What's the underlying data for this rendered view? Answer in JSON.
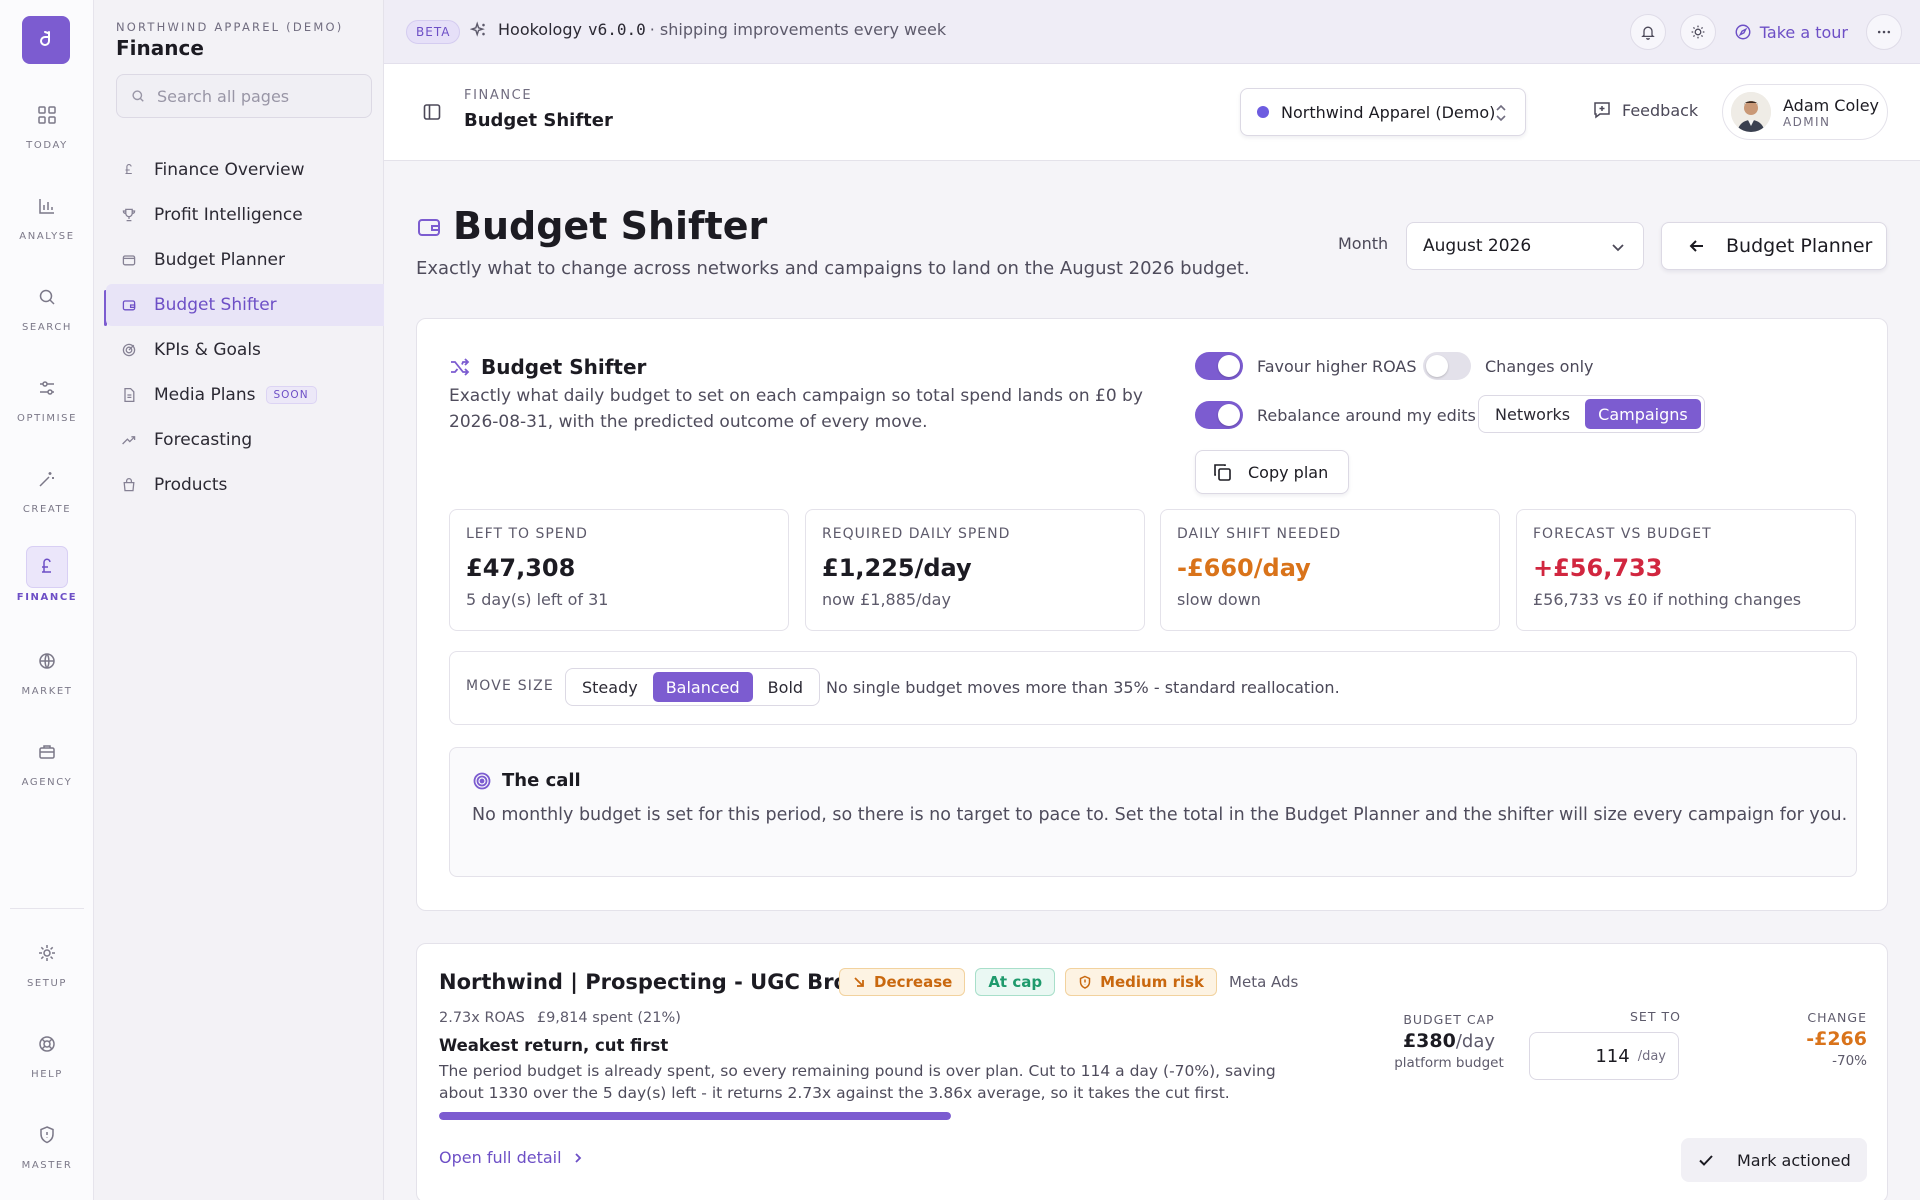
{
  "rail": {
    "logo_letter": "d",
    "items": [
      {
        "label": "TODAY",
        "icon": "grid-icon"
      },
      {
        "label": "ANALYSE",
        "icon": "bar-chart-icon"
      },
      {
        "label": "SEARCH",
        "icon": "search-icon"
      },
      {
        "label": "OPTIMISE",
        "icon": "sliders-icon"
      },
      {
        "label": "CREATE",
        "icon": "magic-wand-icon"
      },
      {
        "label": "FINANCE",
        "icon": "pound-icon"
      },
      {
        "label": "MARKET",
        "icon": "globe-icon"
      },
      {
        "label": "AGENCY",
        "icon": "briefcase-icon"
      },
      {
        "label": "SETUP",
        "icon": "gear-icon"
      },
      {
        "label": "HELP",
        "icon": "lifebuoy-icon"
      },
      {
        "label": "MASTER",
        "icon": "shield-icon"
      }
    ],
    "active": "FINANCE"
  },
  "sidebar": {
    "org": "NORTHWIND APPAREL (DEMO)",
    "section": "Finance",
    "search_placeholder": "Search all pages",
    "items": [
      {
        "label": "Finance Overview",
        "icon": "pound-icon"
      },
      {
        "label": "Profit Intelligence",
        "icon": "trophy-icon"
      },
      {
        "label": "Budget Planner",
        "icon": "wallet-icon"
      },
      {
        "label": "Budget Shifter",
        "icon": "wallet-icon"
      },
      {
        "label": "KPIs & Goals",
        "icon": "target-icon"
      },
      {
        "label": "Media Plans",
        "icon": "document-icon",
        "badge": "SOON"
      },
      {
        "label": "Forecasting",
        "icon": "trend-up-icon"
      },
      {
        "label": "Products",
        "icon": "shopping-bag-icon"
      }
    ],
    "active": "Budget Shifter"
  },
  "banner": {
    "beta": "BETA",
    "app": "Hookology",
    "version": "v6.0.0",
    "tagline": "· shipping improvements every week",
    "tour": "Take a tour"
  },
  "header": {
    "crumb": "FINANCE",
    "title": "Budget Shifter",
    "org_select": "Northwind Apparel (Demo)",
    "feedback": "Feedback",
    "user_name": "Adam Coley",
    "user_role": "ADMIN"
  },
  "page": {
    "title": "Budget Shifter",
    "subtitle": "Exactly what to change across networks and campaigns to land on the August 2026 budget.",
    "month_label": "Month",
    "month_value": "August 2026",
    "planner_button": "Budget Planner"
  },
  "shifter": {
    "title": "Budget Shifter",
    "description": "Exactly what daily budget to set on each campaign so total spend lands on £0 by 2026-08-31, with the predicted outcome of every move.",
    "toggles": {
      "favour_roas": {
        "label": "Favour higher ROAS",
        "on": true
      },
      "changes_only": {
        "label": "Changes only",
        "on": false
      },
      "rebalance": {
        "label": "Rebalance around my edits",
        "on": true
      }
    },
    "view": {
      "options": [
        "Networks",
        "Campaigns"
      ],
      "selected": "Campaigns"
    },
    "copy_plan": "Copy plan",
    "stats": [
      {
        "key": "LEFT TO SPEND",
        "value": "£47,308",
        "sub": "5 day(s) left of 31",
        "tone": "default"
      },
      {
        "key": "REQUIRED DAILY SPEND",
        "value": "£1,225/day",
        "sub": "now £1,885/day",
        "tone": "default"
      },
      {
        "key": "DAILY SHIFT NEEDED",
        "value": "-£660/day",
        "sub": "slow down",
        "tone": "orange"
      },
      {
        "key": "FORECAST VS BUDGET",
        "value": "+£56,733",
        "sub": "£56,733 vs £0 if nothing changes",
        "tone": "red"
      }
    ],
    "move_size": {
      "label": "MOVE SIZE",
      "options": [
        "Steady",
        "Balanced",
        "Bold"
      ],
      "selected": "Balanced",
      "note": "No single budget moves more than 35% - standard reallocation."
    },
    "call": {
      "title": "The call",
      "text": "No monthly budget is set for this period, so there is no target to pace to. Set the total in the Budget Planner and the shifter will size every campaign for you."
    }
  },
  "campaign": {
    "name": "Northwind | Prospecting - UGC Broad",
    "badges": {
      "decrease": "Decrease",
      "cap": "At cap",
      "risk": "Medium risk"
    },
    "network": "Meta Ads",
    "roas": "2.73x ROAS",
    "spent": "£9,814 spent (21%)",
    "headline": "Weakest return, cut first",
    "text": "The period budget is already spent, so every remaining pound is over plan. Cut to 114 a day (-70%), saving about 1330 over the 5 day(s) left - it returns 2.73x against the 3.86x average, so it takes the cut first.",
    "progress_pct": 100,
    "open_detail": "Open full detail",
    "budget_cap_label": "BUDGET CAP",
    "budget_cap_value": "£380",
    "budget_cap_unit": "/day",
    "budget_cap_sub": "platform budget",
    "set_to_label": "SET TO",
    "set_to_value": "114",
    "set_to_unit": "/day",
    "change_label": "CHANGE",
    "change_value": "-£266",
    "change_pct": "-70%",
    "mark_actioned": "Mark actioned"
  },
  "colors": {
    "accent": "#7c5cd0",
    "orange": "#d9731a",
    "red": "#d1263f",
    "green": "#1e9a6c"
  }
}
